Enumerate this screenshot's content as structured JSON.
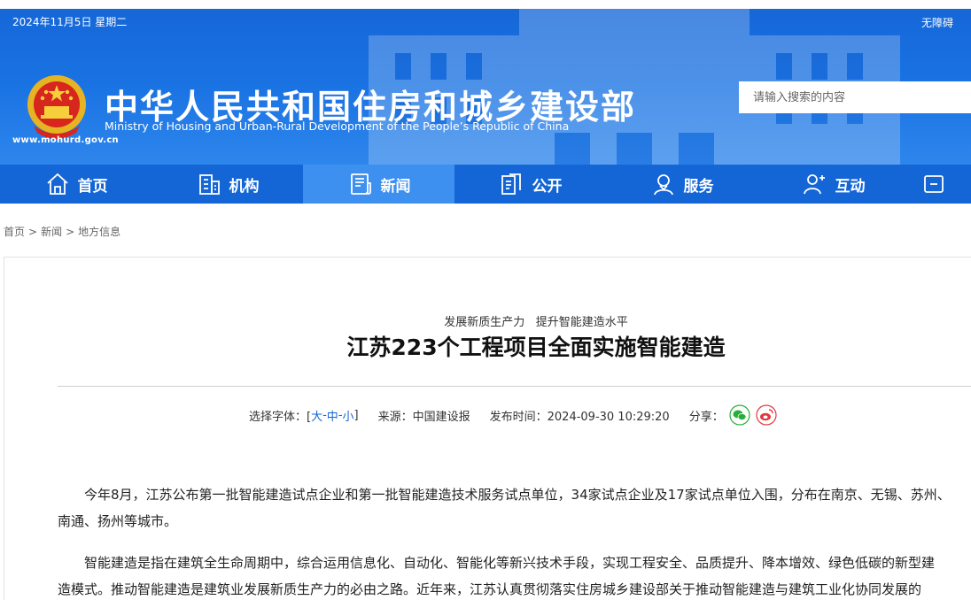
{
  "header": {
    "date": "2024年11月5日 星期二",
    "accessibility": "无障碍",
    "site_url": "www.mohurd.gov.cn",
    "title_cn": "中华人民共和国住房和城乡建设部",
    "title_en": "Ministry of Housing and Urban-Rural Development of the People’s Republic of China",
    "search_placeholder": "请输入搜索的内容"
  },
  "nav": [
    {
      "label": "首页",
      "icon": "home-icon"
    },
    {
      "label": "机构",
      "icon": "building-icon"
    },
    {
      "label": "新闻",
      "icon": "news-icon",
      "active": true
    },
    {
      "label": "公开",
      "icon": "document-icon"
    },
    {
      "label": "服务",
      "icon": "service-icon"
    },
    {
      "label": "互动",
      "icon": "interact-icon"
    }
  ],
  "breadcrumb": [
    "首页",
    "新闻",
    "地方信息"
  ],
  "breadcrumb_sep": ">",
  "article": {
    "subtitle": "发展新质生产力   提升智能建造水平",
    "title": "江苏223个工程项目全面实施智能建造",
    "font_label": "选择字体：[",
    "font_large": "大",
    "font_medium": "中",
    "font_small": "小",
    "font_close": "]",
    "font_dash": "-",
    "source": "来源：中国建设报",
    "publish_time": "发布时间：2024-09-30 10:29:20",
    "share_label": "分享：",
    "paragraphs": [
      [
        "今年8月，江苏公布第一批智能建造试点企业和第一批智能建造技术服务试点单位，34家试点企业及17家试点单位入围，分布在南京、无锡、苏州、",
        "南通、扬州等城市。"
      ],
      [
        "智能建造是指在建筑全生命周期中，综合运用信息化、自动化、智能化等新兴技术手段，实现工程安全、品质提升、降本增效、绿色低碳的新型建",
        "造模式。推动智能建造是建筑业发展新质生产力的必由之路。近年来，江苏认真贯彻落实住房城乡建设部关于推动智能建造与建筑工业化协同发展的"
      ]
    ]
  },
  "colors": {
    "header_blue": "#1a73e3",
    "nav_blue": "#1466d6",
    "nav_active": "#3d8ff0",
    "wechat_green": "#2aae3a",
    "weibo_red": "#e0383e"
  }
}
